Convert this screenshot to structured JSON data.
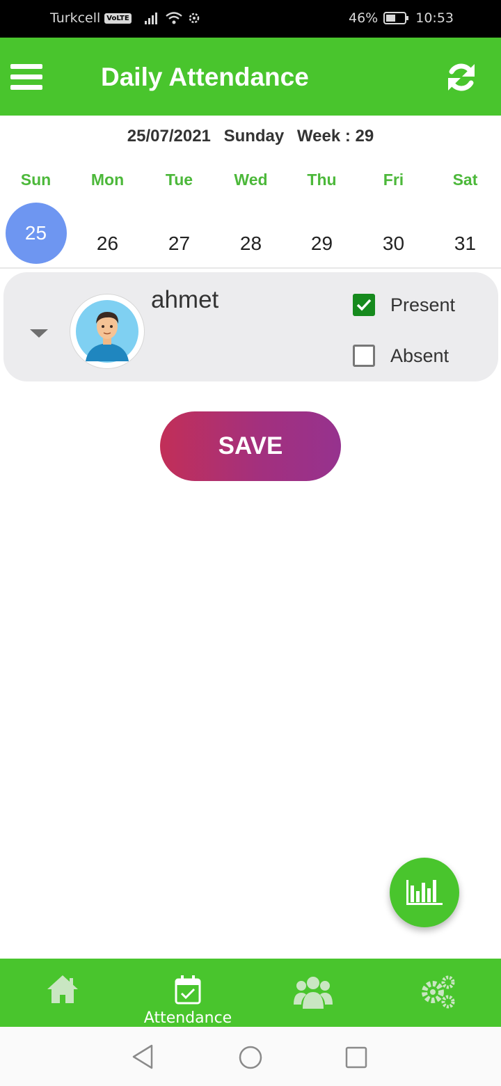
{
  "status_bar": {
    "carrier": "Turkcell",
    "volte": "VoLTE",
    "battery_percent": "46%",
    "time": "10:53"
  },
  "app_bar": {
    "menu_icon": "hamburger-menu-icon",
    "title": "Daily Attendance",
    "refresh_icon": "refresh-icon"
  },
  "date_info": {
    "date": "25/07/2021",
    "weekday": "Sunday",
    "week": "Week : 29"
  },
  "week": [
    {
      "name": "Sun",
      "day": "25",
      "selected": true
    },
    {
      "name": "Mon",
      "day": "26",
      "selected": false
    },
    {
      "name": "Tue",
      "day": "27",
      "selected": false
    },
    {
      "name": "Wed",
      "day": "28",
      "selected": false
    },
    {
      "name": "Thu",
      "day": "29",
      "selected": false
    },
    {
      "name": "Fri",
      "day": "30",
      "selected": false
    },
    {
      "name": "Sat",
      "day": "31",
      "selected": false
    }
  ],
  "students": [
    {
      "name": "ahmet",
      "avatar": "student-avatar",
      "present_label": "Present",
      "present_checked": true,
      "absent_label": "Absent",
      "absent_checked": false
    }
  ],
  "save_label": "SAVE",
  "fab_icon": "bar-chart-icon",
  "bottom_nav": [
    {
      "icon": "home-icon",
      "label": "",
      "active": false
    },
    {
      "icon": "calendar-check-icon",
      "label": "Attendance",
      "active": true
    },
    {
      "icon": "users-icon",
      "label": "",
      "active": false
    },
    {
      "icon": "gears-icon",
      "label": "",
      "active": false
    }
  ],
  "colors": {
    "brand_green": "#49c52d",
    "day_name_green": "#4cb83a",
    "selected_day": "#6e96f1",
    "checkbox_green": "#168a1d",
    "save_gradient_start": "#c22f58",
    "save_gradient_end": "#96328e"
  }
}
